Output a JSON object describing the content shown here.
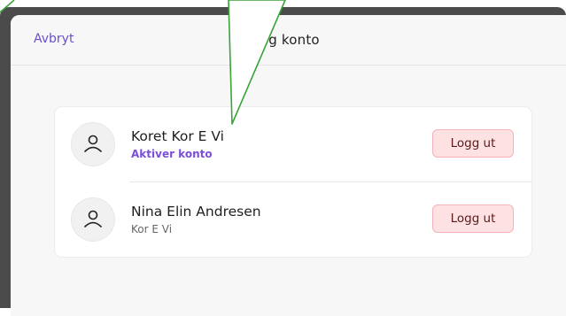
{
  "header": {
    "cancel_label": "Avbryt",
    "title": "g konto"
  },
  "accounts": [
    {
      "name": "Koret Kor E Vi",
      "subtitle": "Aktiver konto",
      "subtitle_is_link": true,
      "logout_label": "Logg ut"
    },
    {
      "name": "Nina Elin Andresen",
      "subtitle": "Kor E Vi",
      "subtitle_is_link": false,
      "logout_label": "Logg ut"
    }
  ],
  "colors": {
    "accent": "#6b4fc9",
    "link": "#7a4fd9",
    "logout_bg": "#fde1e3",
    "logout_border": "#f3b4b8",
    "callout_stroke": "#3aa33a"
  },
  "icons": {
    "avatar": "person-icon"
  }
}
